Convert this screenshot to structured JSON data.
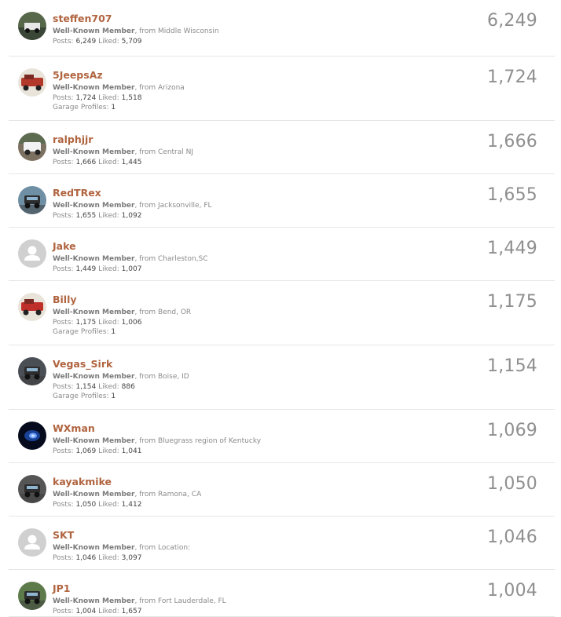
{
  "labels": {
    "title": "Well-Known Member",
    "from": ", from ",
    "posts": "Posts:",
    "liked": "Liked:",
    "garage": "Garage Profiles:"
  },
  "members": [
    {
      "name": "steffen707",
      "location": "Middle Wisconsin",
      "posts": "6,249",
      "liked": "5,709",
      "garage": null,
      "count": "6,249",
      "avatar": "photo-avatar-icon",
      "tone": "#3f4f3a"
    },
    {
      "name": "5JeepsAz",
      "location": "Arizona",
      "posts": "1,724",
      "liked": "1,518",
      "garage": "1",
      "count": "1,724",
      "avatar": "red-jeep-avatar-icon",
      "tone": "#b33a2a"
    },
    {
      "name": "ralphjjr",
      "location": "Central NJ",
      "posts": "1,666",
      "liked": "1,445",
      "garage": null,
      "count": "1,666",
      "avatar": "white-jeep-avatar-icon",
      "tone": "#8a7d66"
    },
    {
      "name": "RedTRex",
      "location": "Jacksonville, FL",
      "posts": "1,655",
      "liked": "1,092",
      "garage": null,
      "count": "1,655",
      "avatar": "jeep-avatar-icon",
      "tone": "#6f8fa5"
    },
    {
      "name": "Jake",
      "location": "Charleston,SC",
      "posts": "1,449",
      "liked": "1,007",
      "garage": null,
      "count": "1,449",
      "avatar": "default-user-avatar-icon",
      "tone": "#cccccc"
    },
    {
      "name": "Billy",
      "location": "Bend, OR",
      "posts": "1,175",
      "liked": "1,006",
      "garage": "1",
      "count": "1,175",
      "avatar": "red-truck-avatar-icon",
      "tone": "#c0302a"
    },
    {
      "name": "Vegas_Sirk",
      "location": "Boise, ID",
      "posts": "1,154",
      "liked": "886",
      "garage": "1",
      "count": "1,154",
      "avatar": "jeep-avatar-icon",
      "tone": "#4a4f55"
    },
    {
      "name": "WXman",
      "location": "Bluegrass region of Kentucky",
      "posts": "1,069",
      "liked": "1,041",
      "garage": null,
      "count": "1,069",
      "avatar": "blue-swirl-avatar-icon",
      "tone": "#1a3b8c"
    },
    {
      "name": "kayakmike",
      "location": "Ramona, CA",
      "posts": "1,050",
      "liked": "1,412",
      "garage": null,
      "count": "1,050",
      "avatar": "jeep-avatar-icon",
      "tone": "#555555"
    },
    {
      "name": "SKT",
      "location": "Location:",
      "posts": "1,046",
      "liked": "3,097",
      "garage": null,
      "count": "1,046",
      "avatar": "default-user-avatar-icon",
      "tone": "#cccccc"
    },
    {
      "name": "JP1",
      "location": "Fort Lauderdale, FL",
      "posts": "1,004",
      "liked": "1,657",
      "garage": null,
      "count": "1,004",
      "avatar": "jeep-avatar-icon",
      "tone": "#5d7a4a"
    }
  ]
}
